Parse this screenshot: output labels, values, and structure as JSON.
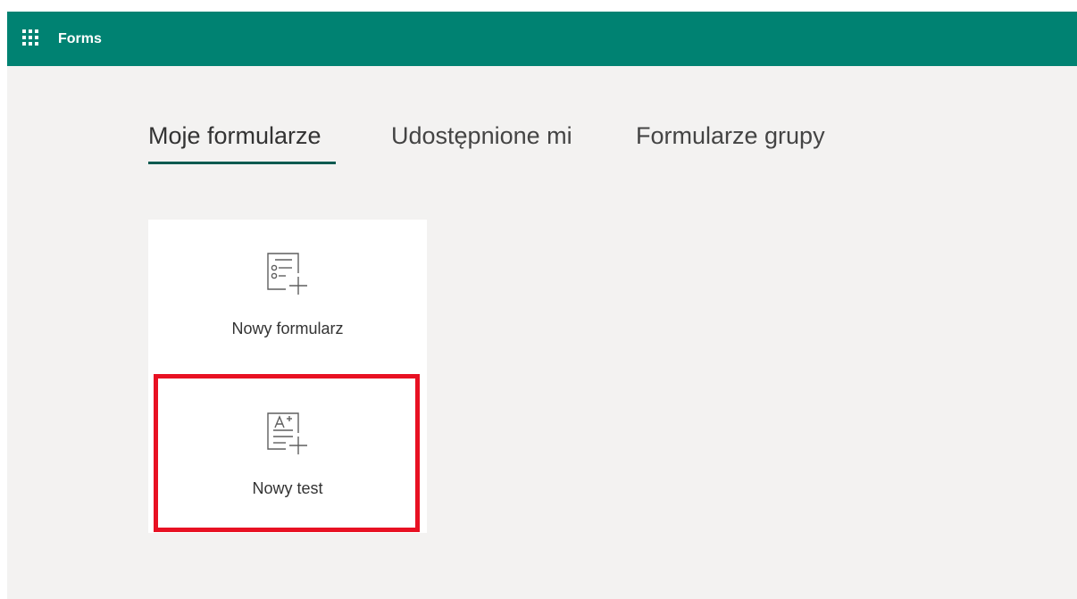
{
  "header": {
    "app_name": "Forms",
    "launcher_icon": "waffle-icon",
    "bar_color": "#008272"
  },
  "tabs": [
    {
      "label": "Moje formularze",
      "active": true
    },
    {
      "label": "Udostępnione mi",
      "active": false
    },
    {
      "label": "Formularze grupy",
      "active": false
    }
  ],
  "cards": {
    "new_form": {
      "label": "Nowy formularz",
      "icon": "new-form-icon"
    },
    "new_quiz": {
      "label": "Nowy test",
      "icon": "new-quiz-icon",
      "highlighted": true
    }
  },
  "colors": {
    "accent": "#008272",
    "tab_underline": "#005a50",
    "highlight": "#e81123",
    "background": "#f3f2f1"
  }
}
